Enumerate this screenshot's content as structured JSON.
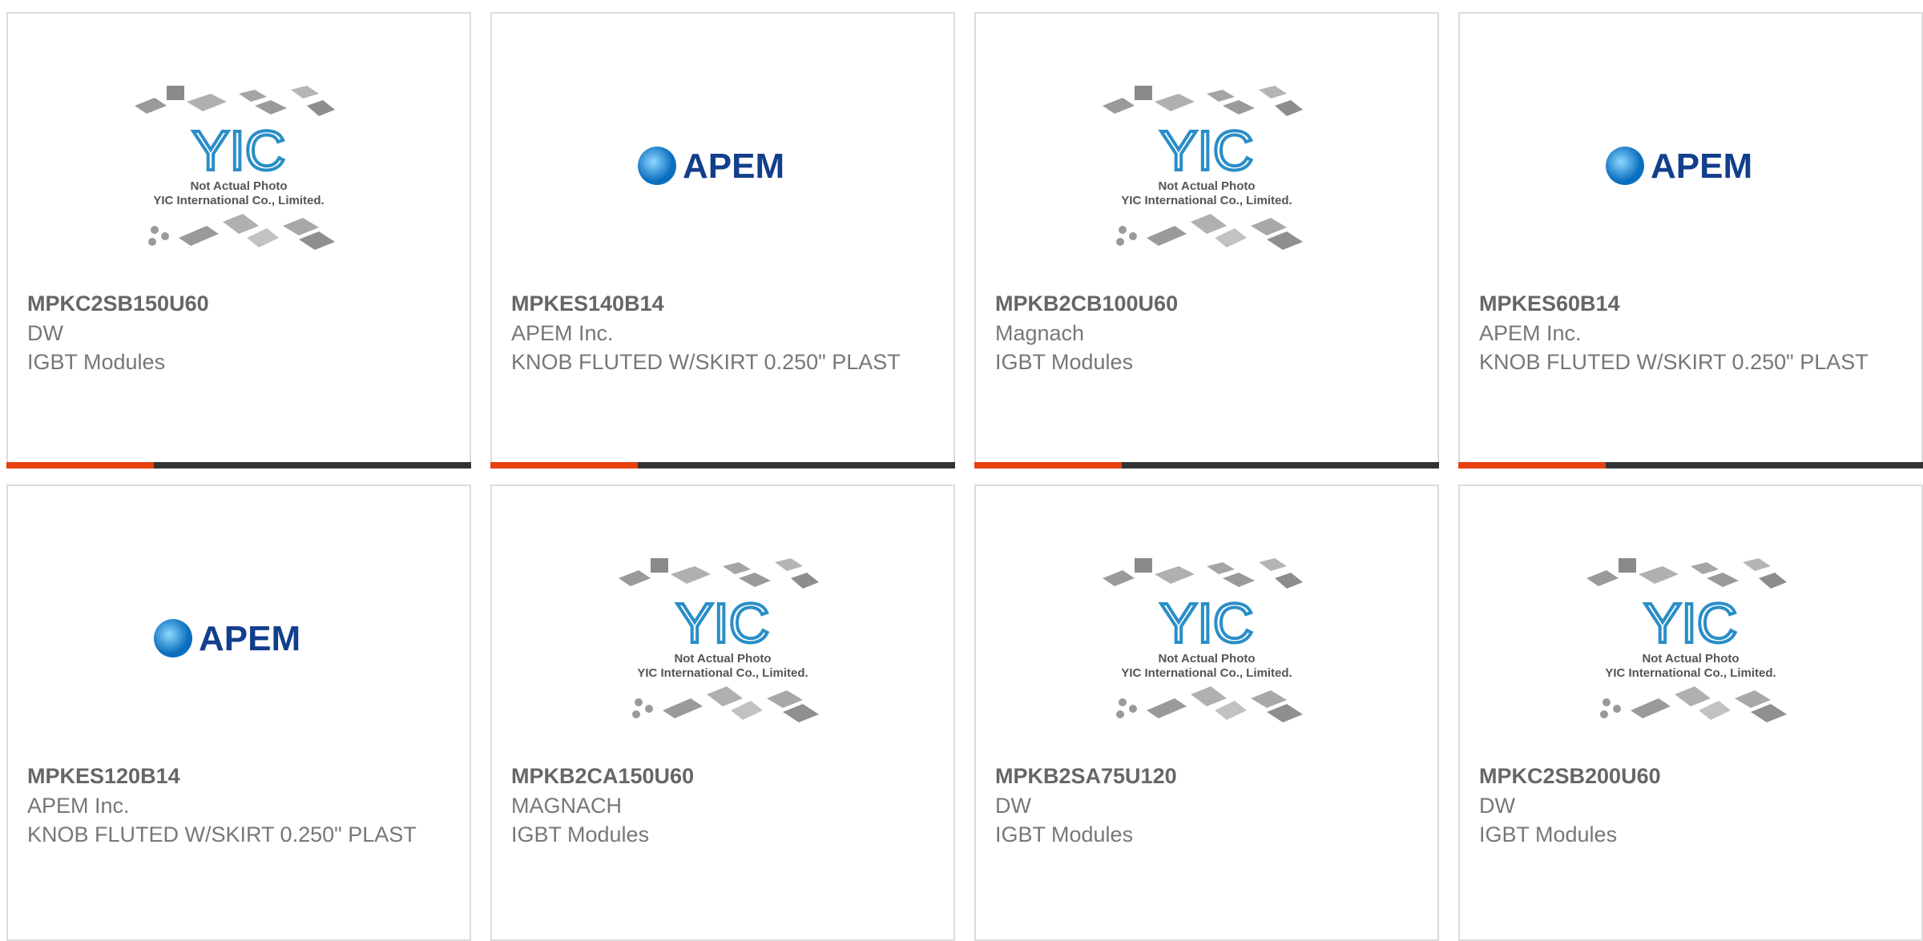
{
  "products": [
    {
      "part_no": "MPKC2SB150U60",
      "maker": "DW",
      "desc": "IGBT Modules",
      "image": "yic-placeholder-icon"
    },
    {
      "part_no": "MPKES140B14",
      "maker": "APEM Inc.",
      "desc": "KNOB FLUTED W/SKIRT 0.250\" PLAST",
      "image": "apem-logo-icon"
    },
    {
      "part_no": "MPKB2CB100U60",
      "maker": "Magnach",
      "desc": "IGBT Modules",
      "image": "yic-placeholder-icon"
    },
    {
      "part_no": "MPKES60B14",
      "maker": "APEM Inc.",
      "desc": "KNOB FLUTED W/SKIRT 0.250\" PLAST",
      "image": "apem-logo-icon"
    },
    {
      "part_no": "MPKES120B14",
      "maker": "APEM Inc.",
      "desc": "KNOB FLUTED W/SKIRT 0.250\" PLAST",
      "image": "apem-logo-icon"
    },
    {
      "part_no": "MPKB2CA150U60",
      "maker": "MAGNACH",
      "desc": "IGBT Modules",
      "image": "yic-placeholder-icon"
    },
    {
      "part_no": "MPKB2SA75U120",
      "maker": "DW",
      "desc": "IGBT Modules",
      "image": "yic-placeholder-icon"
    },
    {
      "part_no": "MPKC2SB200U60",
      "maker": "DW",
      "desc": "IGBT Modules",
      "image": "yic-placeholder-icon"
    }
  ],
  "logos": {
    "apem_text": "APEM",
    "yic_line1": "Not Actual Photo",
    "yic_line2": "YIC International Co., Limited.",
    "yic_mark": "YIC"
  },
  "colors": {
    "accent": "#e8410f",
    "bar": "#333333",
    "apem_blue": "#123f8c"
  }
}
